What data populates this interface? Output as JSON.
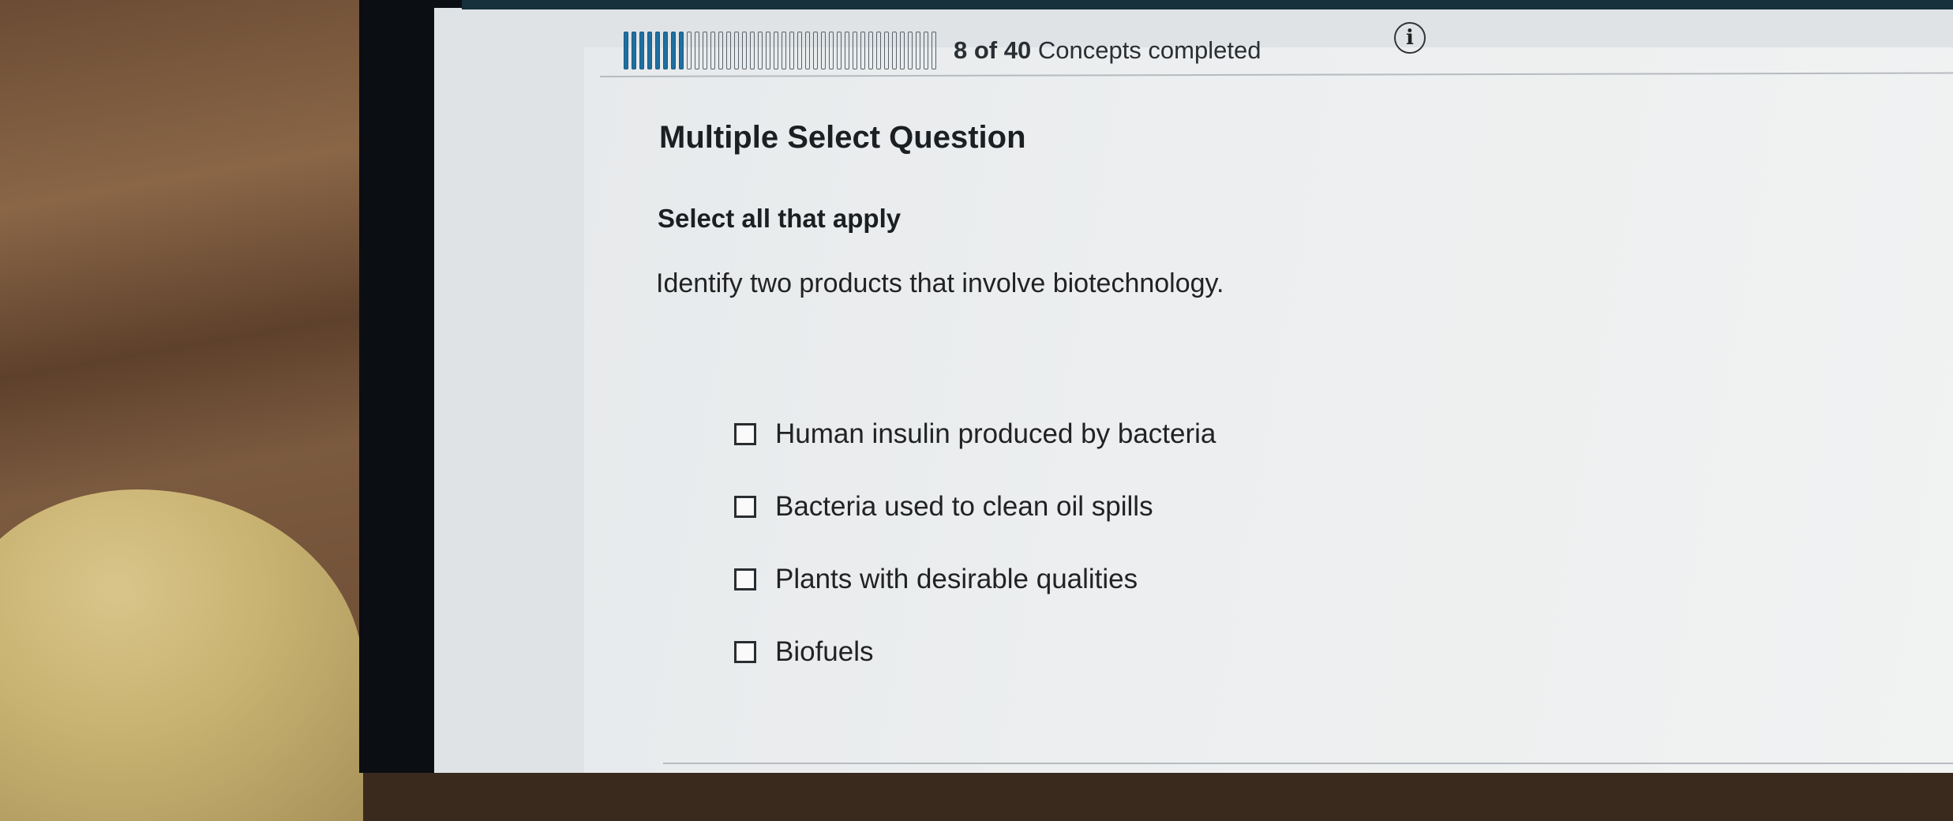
{
  "progress": {
    "completed": 8,
    "total": 40,
    "count_text": "8 of 40",
    "label": "Concepts completed",
    "accent_color": "#1f6fa0"
  },
  "info_icon": {
    "name": "info-icon",
    "glyph": "i"
  },
  "question": {
    "type_label": "Multiple Select Question",
    "instruction": "Select all that apply",
    "prompt": "Identify two products that involve biotechnology.",
    "options": [
      {
        "label": "Human insulin produced by bacteria",
        "checked": false
      },
      {
        "label": "Bacteria used to clean oil spills",
        "checked": false
      },
      {
        "label": "Plants with desirable qualities",
        "checked": false
      },
      {
        "label": "Biofuels",
        "checked": false
      }
    ]
  }
}
